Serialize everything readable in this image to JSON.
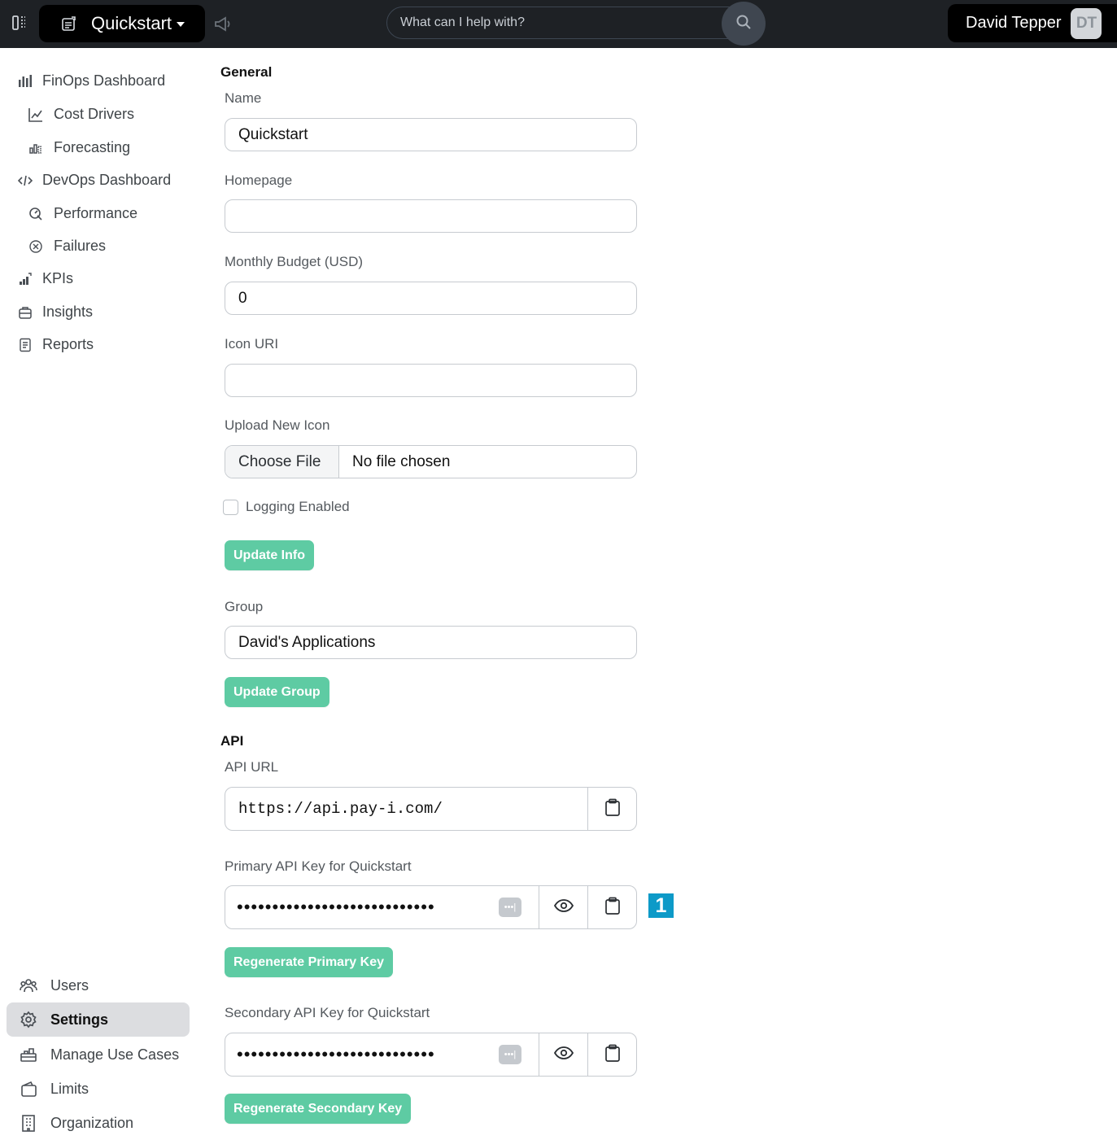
{
  "header": {
    "app_name": "Quickstart",
    "search_placeholder": "What can I help with?",
    "user_name": "David Tepper",
    "user_initials": "DT"
  },
  "sidebar": {
    "items": [
      {
        "label": "FinOps Dashboard",
        "icon": "bar-chart-icon"
      },
      {
        "label": "Cost Drivers",
        "icon": "line-chart-icon"
      },
      {
        "label": "Forecasting",
        "icon": "forecast-chart-icon"
      },
      {
        "label": "DevOps Dashboard",
        "icon": "code-icon"
      },
      {
        "label": "Performance",
        "icon": "speedometer-icon"
      },
      {
        "label": "Failures",
        "icon": "x-circle-icon"
      },
      {
        "label": "KPIs",
        "icon": "kpi-icon"
      },
      {
        "label": "Insights",
        "icon": "insights-icon"
      },
      {
        "label": "Reports",
        "icon": "document-icon"
      }
    ],
    "bottom_items": [
      {
        "label": "Users",
        "icon": "users-icon"
      },
      {
        "label": "Settings",
        "icon": "gear-icon",
        "active": true
      },
      {
        "label": "Manage Use Cases",
        "icon": "use-cases-icon"
      },
      {
        "label": "Limits",
        "icon": "wallet-icon"
      },
      {
        "label": "Organization",
        "icon": "building-icon"
      }
    ]
  },
  "general": {
    "title": "General",
    "name_label": "Name",
    "name_value": "Quickstart",
    "homepage_label": "Homepage",
    "homepage_value": "",
    "budget_label": "Monthly Budget (USD)",
    "budget_value": "0",
    "icon_uri_label": "Icon URI",
    "icon_uri_value": "",
    "upload_label": "Upload New Icon",
    "choose_file": "Choose File",
    "file_status": "No file chosen",
    "logging_label": "Logging Enabled",
    "logging_enabled": false,
    "update_info": "Update Info",
    "group_label": "Group",
    "group_value": "David's Applications",
    "update_group": "Update Group"
  },
  "api": {
    "title": "API",
    "url_label": "API URL",
    "url_value": "https://api.pay-i.com/",
    "primary_label": "Primary API Key for Quickstart",
    "primary_masked": "••••••••••••••••••••••••••••",
    "regen_primary": "Regenerate Primary Key",
    "secondary_label": "Secondary API Key for Quickstart",
    "secondary_masked": "••••••••••••••••••••••••••••",
    "regen_secondary": "Regenerate Secondary Key",
    "marker_number": "1"
  },
  "colors": {
    "topbar": "#1e2125",
    "accent_green": "#5ecba3",
    "marker_blue": "#0d9ac8",
    "active_nav": "#dcdde0"
  }
}
